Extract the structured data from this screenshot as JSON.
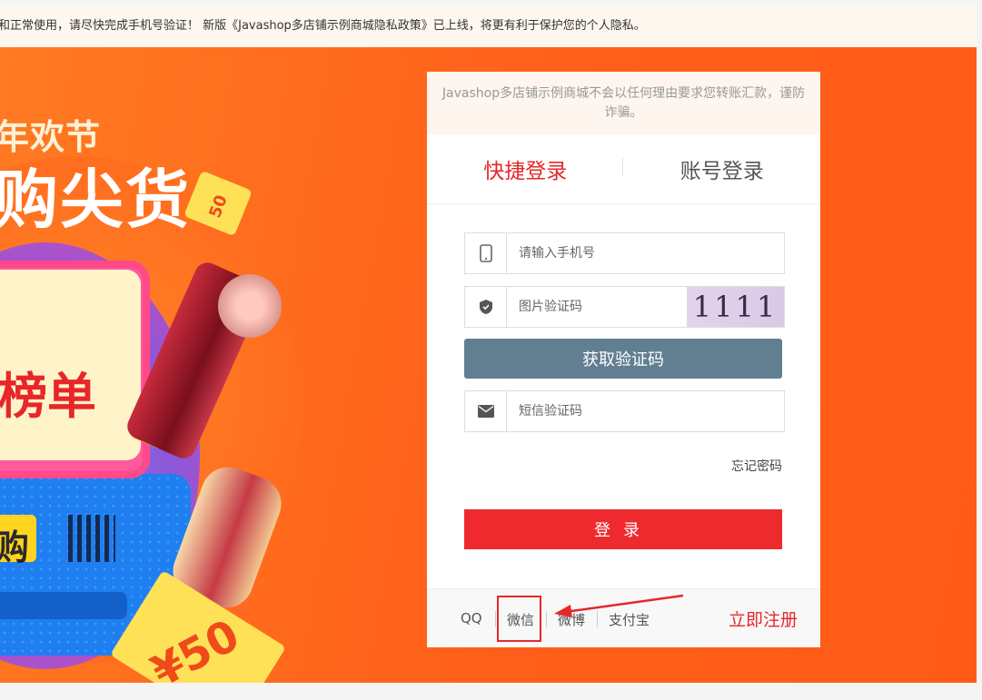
{
  "notice": {
    "text": "和正常使用，请尽快完成手机号验证！ 新版《Javashop多店铺示例商城隐私政策》已上线，将更有利于保护您的个人隐私。"
  },
  "banner": {
    "line1": "年欢节",
    "line2": "购尖货",
    "line3": "榜单",
    "line4": "购",
    "coupon_small": "50",
    "coupon_big": "¥50"
  },
  "login": {
    "tip": "Javashop多店铺示例商城不会以任何理由要求您转账汇款，谨防诈骗。",
    "tabs": [
      {
        "label": "快捷登录",
        "active": true
      },
      {
        "label": "账号登录",
        "active": false
      }
    ],
    "phone_placeholder": "请输入手机号",
    "image_code_placeholder": "图片验证码",
    "captcha_text": "1111",
    "get_code_label": "获取验证码",
    "sms_code_placeholder": "短信验证码",
    "forgot_label": "忘记密码",
    "submit_label": "登录",
    "social": [
      "QQ",
      "微信",
      "微博",
      "支付宝"
    ],
    "register_label": "立即注册"
  },
  "colors": {
    "accent": "#e4282b",
    "button_gray": "#627f91",
    "banner": "#ff5f1a"
  },
  "icons": {
    "phone": "phone-icon",
    "shield": "shield-icon",
    "mail": "mail-icon"
  }
}
